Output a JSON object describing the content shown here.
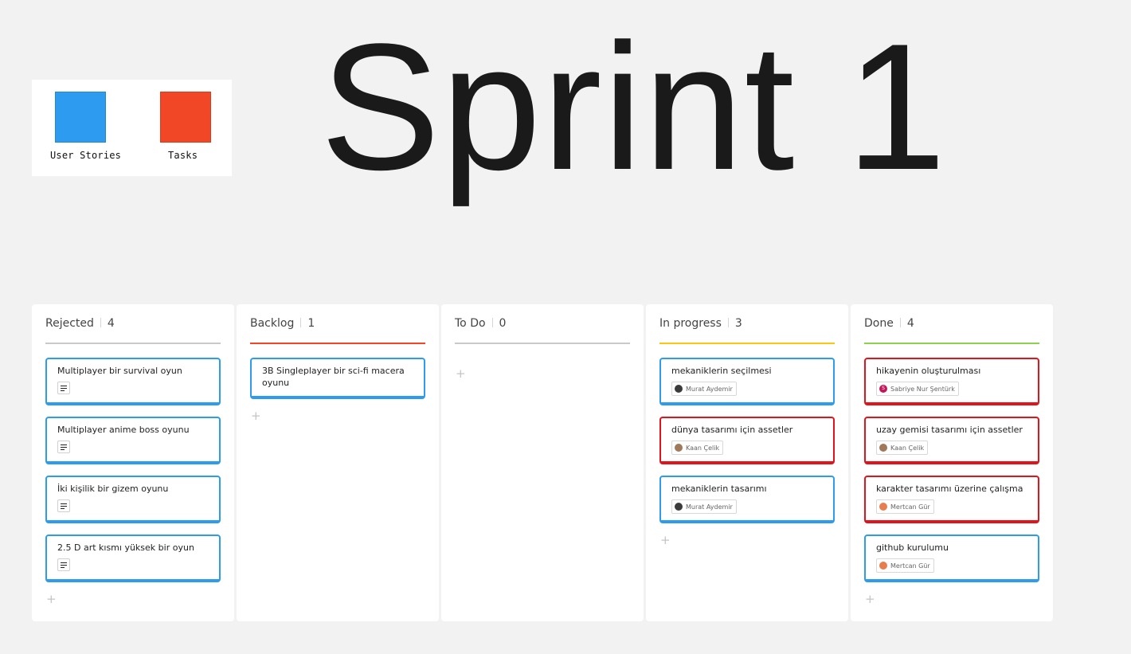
{
  "legend": {
    "items": [
      {
        "label": "User Stories",
        "color": "#2d9bf0"
      },
      {
        "label": "Tasks",
        "color": "#f24726"
      }
    ]
  },
  "title": "Sprint 1",
  "colors": {
    "story": "#2d9bf0",
    "task": "#e2131a",
    "rejected_rule": "#c9c9c9",
    "backlog_rule": "#f24726",
    "todo_rule": "#c9c9c9",
    "inprogress_rule": "#fac710",
    "done_rule": "#8fd14f"
  },
  "columns": [
    {
      "name": "Rejected",
      "count": "4",
      "cards": [
        {
          "title": "Multiplayer bir survival oyun",
          "type": "story",
          "icon": "description-icon"
        },
        {
          "title": "Multiplayer anime boss oyunu",
          "type": "story",
          "icon": "description-icon"
        },
        {
          "title": "İki kişilik bir gizem oyunu",
          "type": "story",
          "icon": "description-icon"
        },
        {
          "title": "2.5 D art kısmı yüksek bir oyun",
          "type": "story",
          "icon": "description-icon"
        }
      ],
      "add": "+"
    },
    {
      "name": "Backlog",
      "count": "1",
      "cards": [
        {
          "title": "3B Singleplayer bir sci-fi macera oyunu",
          "type": "story"
        }
      ],
      "add": "+"
    },
    {
      "name": "To Do",
      "count": "0",
      "cards": [],
      "add": "+"
    },
    {
      "name": "In progress",
      "count": "3",
      "cards": [
        {
          "title": "mekaniklerin seçilmesi",
          "type": "story",
          "assignee": "Murat Aydemir"
        },
        {
          "title": "dünya tasarımı için assetler",
          "type": "task",
          "assignee": "Kaan Çelik"
        },
        {
          "title": "mekaniklerin tasarımı",
          "type": "story",
          "assignee": "Murat Aydemir"
        }
      ],
      "add": "+"
    },
    {
      "name": "Done",
      "count": "4",
      "cards": [
        {
          "title": "hikayenin oluşturulması",
          "type": "task",
          "assignee": "Sabriye Nur Şentürk",
          "avatar_letter": "S"
        },
        {
          "title": "uzay gemisi tasarımı için assetler",
          "type": "task",
          "assignee": "Kaan Çelik"
        },
        {
          "title": "karakter tasarımı üzerine çalışma",
          "type": "task",
          "assignee": "Mertcan Gür"
        },
        {
          "title": "github kurulumu",
          "type": "story",
          "assignee": "Mertcan Gür"
        }
      ],
      "add": "+"
    }
  ]
}
